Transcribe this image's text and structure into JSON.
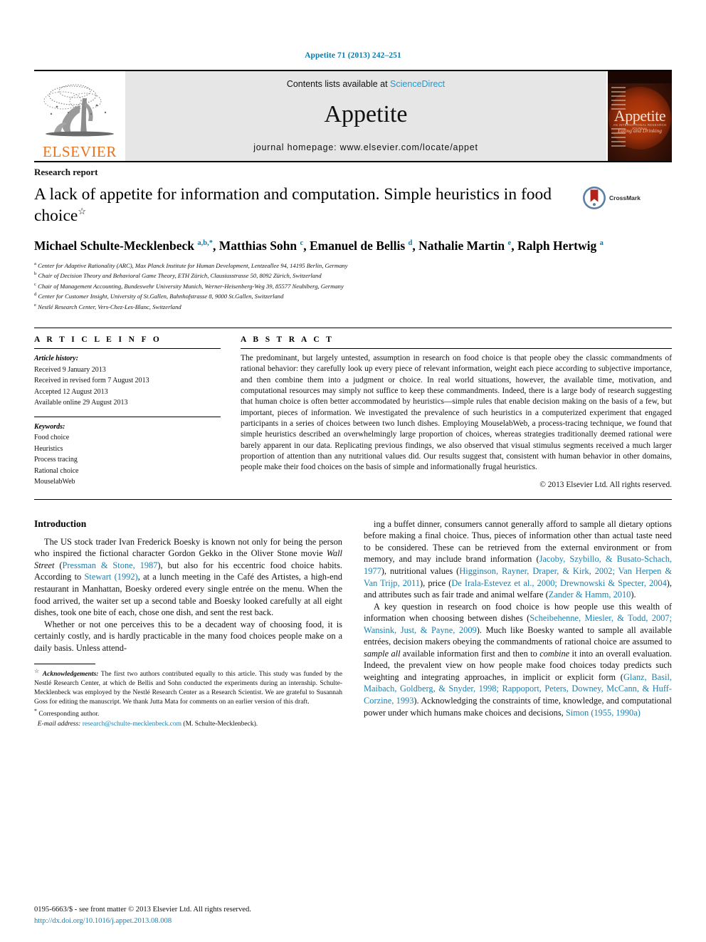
{
  "running_head": "Appetite 71 (2013) 242–251",
  "masthead": {
    "publisher_name": "ELSEVIER",
    "contents_prefix": "Contents lists available at ",
    "sciencedirect": "ScienceDirect",
    "journal_title": "Appetite",
    "homepage": "journal homepage: www.elsevier.com/locate/appet",
    "cover_title": "Appetite",
    "cover_sub1": "AN INTERNATIONAL RESEARCH JOURNAL",
    "cover_sub2": "Eating and Drinking"
  },
  "article": {
    "kicker": "Research report",
    "title": "A lack of appetite for information and computation. Simple heuristics in food choice",
    "title_footnote_marker": "☆",
    "crossmark_label": "CrossMark",
    "authors_html": "Michael Schulte-Mecklenbeck <sup>a,b,</sup><sup>*</sup>, Matthias Sohn <sup>c</sup>, Emanuel de Bellis <sup>d</sup>, Nathalie Martin <sup>e</sup>, Ralph Hertwig <sup>a</sup>",
    "affiliations": [
      {
        "marker": "a",
        "text": "Center for Adaptive Rationality (ARC), Max Planck Institute for Human Development, Lentzeallee 94, 14195 Berlin, Germany"
      },
      {
        "marker": "b",
        "text": "Chair of Decision Theory and Behavioral Game Theory, ETH Zürich, Clausiusstrasse 50, 8092 Zürich, Switzerland"
      },
      {
        "marker": "c",
        "text": "Chair of Management Accounting, Bundeswehr University Munich, Werner-Heisenberg-Weg 39, 85577 Neubiberg, Germany"
      },
      {
        "marker": "d",
        "text": "Center for Customer Insight, University of St.Gallen, Bahnhofstrasse 8, 9000 St.Gallen, Switzerland"
      },
      {
        "marker": "e",
        "text": "Nestlé Research Center, Vers-Chez-Les-Blanc, Switzerland"
      }
    ]
  },
  "article_info": {
    "heading": "A R T I C L E    I N F O",
    "history_label": "Article history:",
    "history": [
      "Received 9 January 2013",
      "Received in revised form 7 August 2013",
      "Accepted 12 August 2013",
      "Available online 29 August 2013"
    ],
    "keywords_label": "Keywords:",
    "keywords": [
      "Food choice",
      "Heuristics",
      "Process tracing",
      "Rational choice",
      "MouselabWeb"
    ]
  },
  "abstract": {
    "heading": "A B S T R A C T",
    "text": "The predominant, but largely untested, assumption in research on food choice is that people obey the classic commandments of rational behavior: they carefully look up every piece of relevant information, weight each piece according to subjective importance, and then combine them into a judgment or choice. In real world situations, however, the available time, motivation, and computational resources may simply not suffice to keep these commandments. Indeed, there is a large body of research suggesting that human choice is often better accommodated by heuristics—simple rules that enable decision making on the basis of a few, but important, pieces of information. We investigated the prevalence of such heuristics in a computerized experiment that engaged participants in a series of choices between two lunch dishes. Employing MouselabWeb, a process-tracing technique, we found that simple heuristics described an overwhelmingly large proportion of choices, whereas strategies traditionally deemed rational were barely apparent in our data. Replicating previous findings, we also observed that visual stimulus segments received a much larger proportion of attention than any nutritional values did. Our results suggest that, consistent with human behavior in other domains, people make their food choices on the basis of simple and informationally frugal heuristics.",
    "copyright": "© 2013 Elsevier Ltd. All rights reserved."
  },
  "body": {
    "intro_heading": "Introduction",
    "left_paragraphs_html": [
      "The US stock trader Ivan Frederick Boesky is known not only for being the person who inspired the fictional character Gordon Gekko in the Oliver Stone movie <span class=\"it\">Wall Street</span> (<span class=\"ref\">Pressman &amp; Stone, 1987</span>), but also for his eccentric food choice habits. According to <span class=\"ref\">Stewart (1992)</span>, at a lunch meeting in the Café des Artistes, a high-end restaurant in Manhattan, Boesky ordered every single entrée on the menu. When the food arrived, the waiter set up a second table and Boesky looked carefully at all eight dishes, took one bite of each, chose one dish, and sent the rest back.",
      "Whether or not one perceives this to be a decadent way of choosing food, it is certainly costly, and is hardly practicable in the many food choices people make on a daily basis. Unless attend-"
    ],
    "right_paragraphs_html": [
      "ing a buffet dinner, consumers cannot generally afford to sample all dietary options before making a final choice. Thus, pieces of information other than actual taste need to be considered. These can be retrieved from the external environment or from memory, and may include brand information (<span class=\"ref\">Jacoby, Szybillo, &amp; Busato-Schach, 1977</span>), nutritional values (<span class=\"ref\">Higginson, Rayner, Draper, &amp; Kirk, 2002; Van Herpen &amp; Van Trijp, 2011</span>), price (<span class=\"ref\">De Irala-Estevez et al., 2000; Drewnowski &amp; Specter, 2004</span>), and attributes such as fair trade and animal welfare (<span class=\"ref\">Zander &amp; Hamm, 2010</span>).",
      "A key question in research on food choice is how people use this wealth of information when choosing between dishes (<span class=\"ref\">Scheibehenne, Miesler, &amp; Todd, 2007; Wansink, Just, &amp; Payne, 2009</span>). Much like Boesky wanted to sample all available entrées, decision makers obeying the commandments of rational choice are assumed to <span class=\"it\">sample all</span> available information first and then to <span class=\"it\">combine</span> it into an overall evaluation. Indeed, the prevalent view on how people make food choices today predicts such weighting and integrating approaches, in implicit or explicit form (<span class=\"ref\">Glanz, Basil, Maibach, Goldberg, &amp; Snyder, 1998; Rappoport, Peters, Downey, McCann, &amp; Huff-Corzine, 1993</span>). Acknowledging the constraints of time, knowledge, and computational power under which humans make choices and decisions, <span class=\"ref\">Simon (1955, 1990a)</span>"
    ]
  },
  "footnotes": {
    "acknowledgement_marker": "☆",
    "acknowledgement_label": "Acknowledgements:",
    "acknowledgement_text": "The first two authors contributed equally to this article. This study was funded by the Nestlé Research Center, at which de Bellis and Sohn conducted the experiments during an internship. Schulte-Mecklenbeck was employed by the Nestlé Research Center as a Research Scientist. We are grateful to Susannah Goss for editing the manuscript. We thank Jutta Mata for comments on an earlier version of this draft.",
    "corresponding_marker": "*",
    "corresponding_text": "Corresponding author.",
    "email_label": "E-mail address:",
    "email": "research@schulte-mecklenbeck.com",
    "email_suffix": "(M. Schulte-Mecklenbeck)."
  },
  "page_footer": {
    "issn_line": "0195-6663/$ - see front matter © 2013 Elsevier Ltd. All rights reserved.",
    "doi_line": "http://dx.doi.org/10.1016/j.appet.2013.08.008"
  },
  "colors": {
    "link": "#1b7fae",
    "running_head": "#0b7ba8",
    "elsevier_orange": "#E8711A",
    "sciencedirect": "#1b9ad6",
    "masthead_bg": "#e6e6e6"
  }
}
